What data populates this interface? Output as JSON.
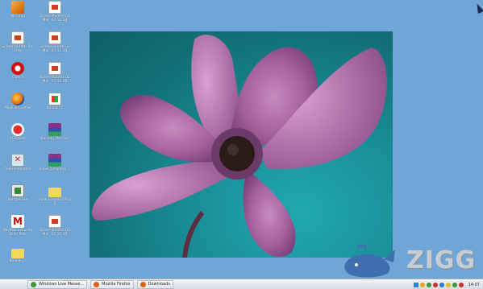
{
  "desktop": {
    "icons": [
      {
        "label": "Winamp",
        "icon": "winamp-icon"
      },
      {
        "label": "Screenhunter 01 Mar. 07.11.34",
        "icon": "screenshot-file-icon"
      },
      {
        "label": "ScreenHunter 5.0 Free",
        "icon": "screenhunter-icon"
      },
      {
        "label": "ScreenHunter 02 Mar. 07.11.35",
        "icon": "screenshot-file-icon"
      },
      {
        "label": "Opera",
        "icon": "opera-icon"
      },
      {
        "label": "Screenhunter 02 Mar. 07.11.35",
        "icon": "screenshot-file-icon"
      },
      {
        "label": "Mozilla Firefox",
        "icon": "firefox-icon"
      },
      {
        "label": "Baixaki C",
        "icon": "windows-icon"
      },
      {
        "label": "CCleaner",
        "icon": "ccleaner-icon"
      },
      {
        "label": "Baixaki_themes",
        "icon": "winrar-icon"
      },
      {
        "label": "FileUnsealable",
        "icon": "file-unsealable-icon"
      },
      {
        "label": "Snow_Leopard_...",
        "icon": "winrar-icon"
      },
      {
        "label": "Setupe.exe",
        "icon": "setup-icon"
      },
      {
        "label": "Snow Leopard Pack 2",
        "icon": "folder-icon"
      },
      {
        "label": "McAfee Security Scan Plus",
        "icon": "mcafee-icon"
      },
      {
        "label": "Screenhunter 01 Mar. 07.11.35",
        "icon": "screenshot-file-icon"
      },
      {
        "label": "Baixaki C",
        "icon": "folder-icon"
      }
    ]
  },
  "taskbar": {
    "buttons": [
      {
        "label": "Windows Live Messe...",
        "icon": "messenger-icon",
        "color": "#3a9a3a"
      },
      {
        "label": "Mozilla Firefox",
        "icon": "firefox-icon",
        "color": "#e06010"
      },
      {
        "label": "Downloads",
        "icon": "firefox-icon",
        "color": "#e06010"
      }
    ],
    "clock": "14:07",
    "tray_colors": [
      "#f0a020",
      "#3a9a3a",
      "#d03030",
      "#2a7ad0",
      "#e0c020",
      "#3a9a3a",
      "#d03030"
    ]
  },
  "watermark": {
    "text": "ZIGG",
    "mascot": "whale-icon"
  },
  "colors": {
    "desktop": "#6fa6d6",
    "flower": "#b06aa8",
    "photo_bg": "#1a8f98"
  }
}
